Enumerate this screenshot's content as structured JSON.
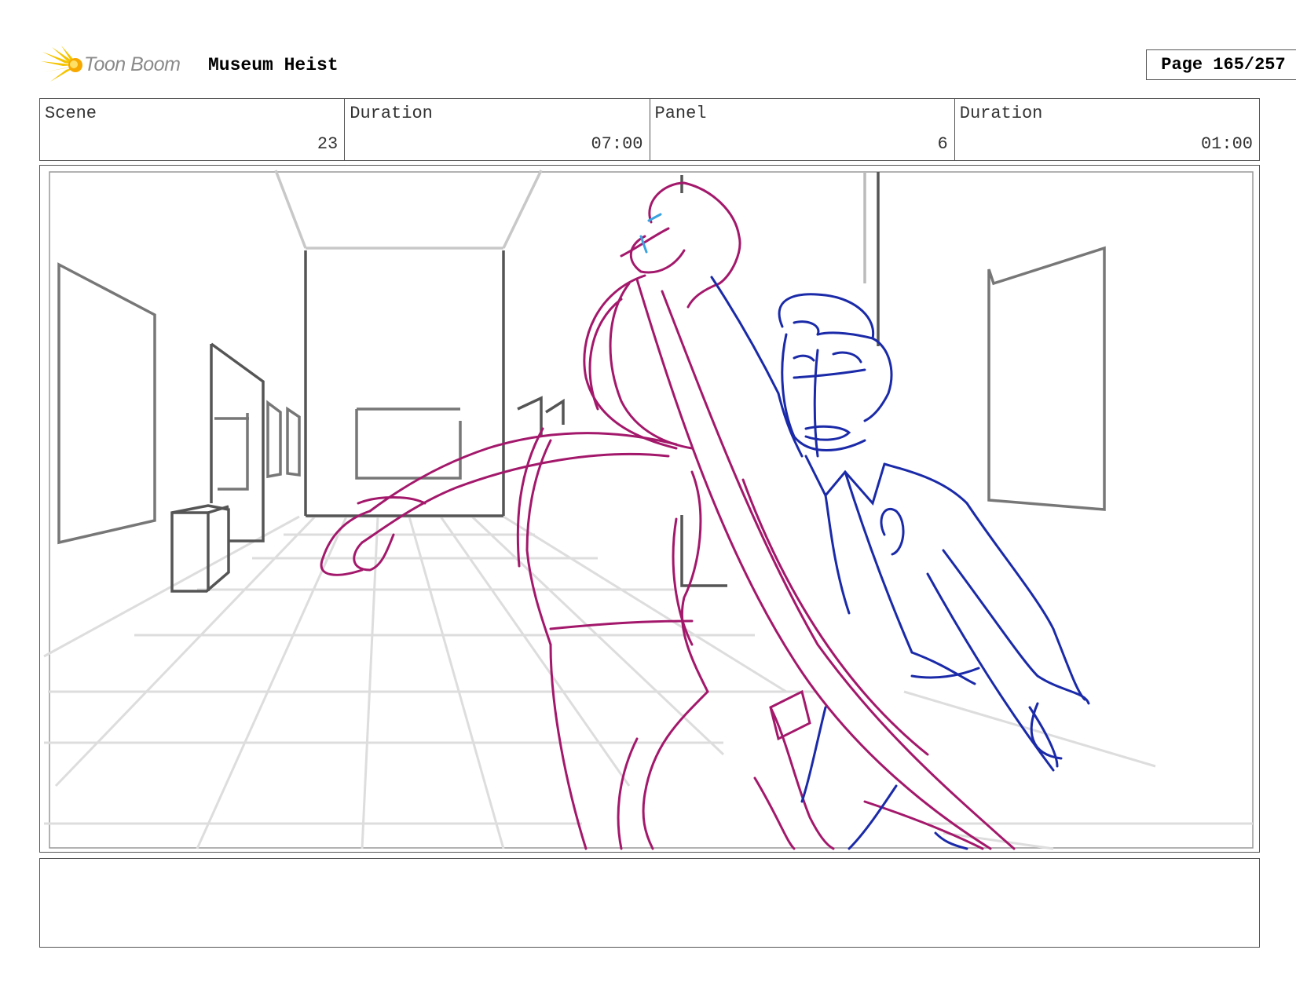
{
  "header": {
    "logo_text": "Toon Boom",
    "project_title": "Museum Heist",
    "page_label": "Page 165/257"
  },
  "info": {
    "scene_label": "Scene",
    "scene_value": "23",
    "scene_duration_label": "Duration",
    "scene_duration_value": "07:00",
    "panel_label": "Panel",
    "panel_value": "6",
    "panel_duration_label": "Duration",
    "panel_duration_value": "01:00"
  },
  "notes": {
    "text": ""
  },
  "colors": {
    "thief_sketch": "#a3186b",
    "guard_sketch": "#1a2aa8",
    "background_sketch": "#555555",
    "floor_grid": "#dddddd",
    "logo_accent": "#f5c400"
  }
}
